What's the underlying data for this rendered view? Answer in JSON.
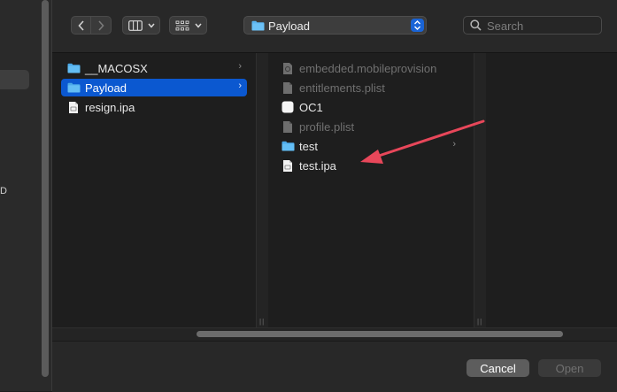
{
  "toolbar": {
    "back_icon": "chevron-left-icon",
    "forward_icon": "chevron-right-icon",
    "view_columns_icon": "columns-view-icon",
    "group_icon": "grid-group-icon",
    "path_label": "Payload",
    "search_placeholder": "Search"
  },
  "sidebar": {
    "partial_letter": "D"
  },
  "columns": [
    {
      "items": [
        {
          "label": "__MACOSX",
          "icon": "folder-icon",
          "has_children": true,
          "selected": false,
          "dim": false
        },
        {
          "label": "Payload",
          "icon": "folder-icon",
          "has_children": true,
          "selected": true,
          "dim": false
        },
        {
          "label": "resign.ipa",
          "icon": "document-icon",
          "has_children": false,
          "selected": false,
          "dim": false
        }
      ]
    },
    {
      "items": [
        {
          "label": "embedded.mobileprovision",
          "icon": "provision-file-icon",
          "has_children": false,
          "selected": false,
          "dim": true
        },
        {
          "label": "entitlements.plist",
          "icon": "document-icon",
          "has_children": false,
          "selected": false,
          "dim": true
        },
        {
          "label": "OC1",
          "icon": "executable-icon",
          "has_children": false,
          "selected": false,
          "dim": false
        },
        {
          "label": "profile.plist",
          "icon": "document-icon",
          "has_children": false,
          "selected": false,
          "dim": true
        },
        {
          "label": "test",
          "icon": "folder-icon",
          "has_children": true,
          "selected": false,
          "dim": false
        },
        {
          "label": "test.ipa",
          "icon": "document-icon",
          "has_children": false,
          "selected": false,
          "dim": false
        }
      ]
    }
  ],
  "annotation": {
    "color": "#e8475a"
  },
  "footer": {
    "cancel_label": "Cancel",
    "open_label": "Open"
  },
  "colors": {
    "accent": "#0b58d0",
    "folder": "#5ab4f0"
  }
}
